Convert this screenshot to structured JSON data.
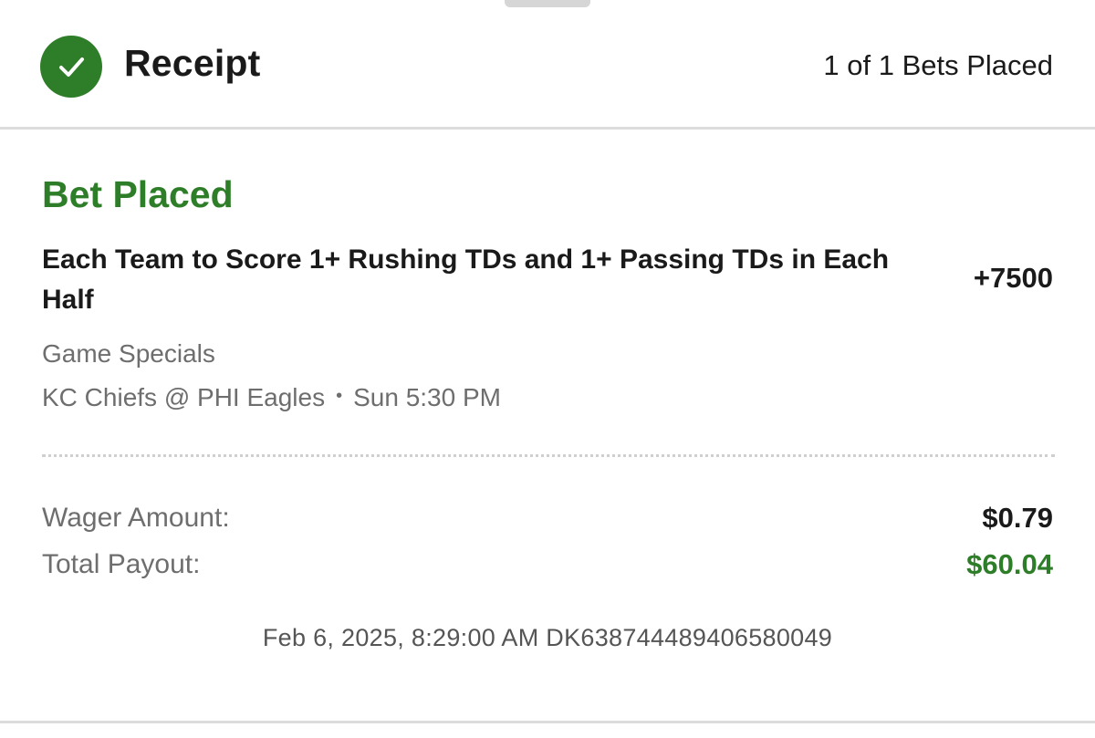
{
  "header": {
    "title": "Receipt",
    "bets_count": "1 of 1 Bets Placed",
    "icon": "check-circle-icon"
  },
  "bet": {
    "status": "Bet Placed",
    "title": "Each Team to Score 1+ Rushing TDs and 1+ Passing TDs in Each Half",
    "odds": "+7500",
    "category": "Game Specials",
    "matchup": "KC Chiefs @ PHI Eagles",
    "separator": "•",
    "time": "Sun 5:30 PM"
  },
  "summary": {
    "wager_label": "Wager Amount:",
    "wager_value": "$0.79",
    "payout_label": "Total Payout:",
    "payout_value": "$60.04"
  },
  "footer": {
    "timestamp_id": "Feb 6, 2025, 8:29:00 AM DK638744489406580049"
  },
  "colors": {
    "accent_green": "#2e7d28",
    "text_primary": "#1a1a1a",
    "text_secondary": "#6e6e6e"
  }
}
